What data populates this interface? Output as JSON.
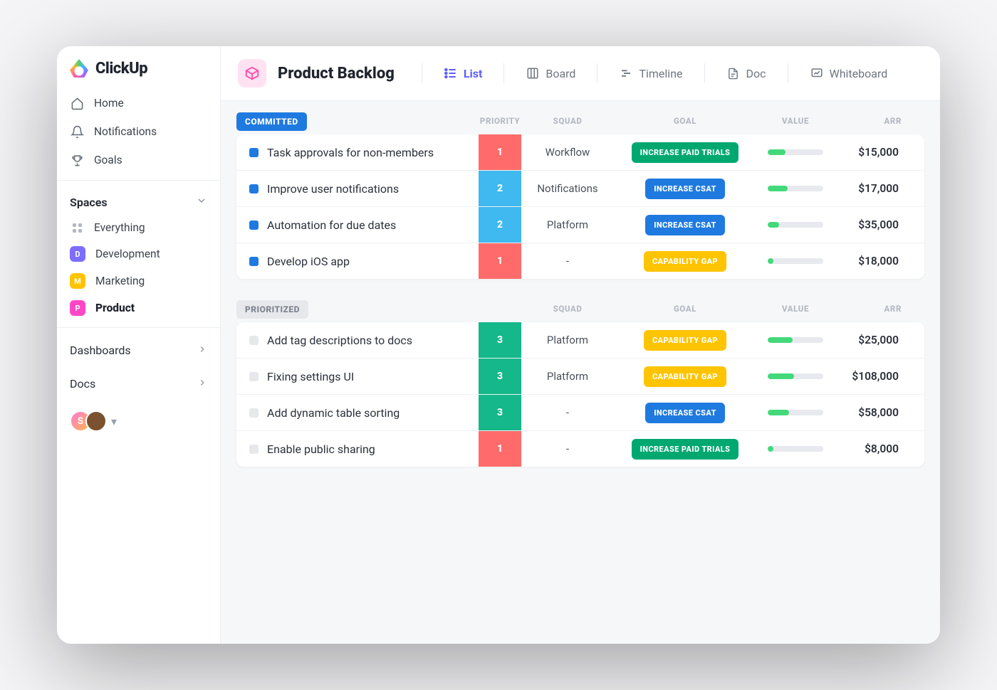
{
  "brand": "ClickUp",
  "sidebar": {
    "nav": [
      {
        "label": "Home"
      },
      {
        "label": "Notifications"
      },
      {
        "label": "Goals"
      }
    ],
    "spaces_label": "Spaces",
    "spaces": [
      {
        "label": "Everything",
        "kind": "everything"
      },
      {
        "label": "Development",
        "badge": "D",
        "color": "#7c6dff"
      },
      {
        "label": "Marketing",
        "badge": "M",
        "color": "#ffc400"
      },
      {
        "label": "Product",
        "badge": "P",
        "color": "#ff47c6",
        "active": true
      }
    ],
    "links": [
      {
        "label": "Dashboards"
      },
      {
        "label": "Docs"
      }
    ],
    "avatars": [
      {
        "initial": "S"
      },
      {
        "initial": ""
      }
    ]
  },
  "header": {
    "title": "Product Backlog",
    "views": [
      {
        "label": "List",
        "active": true
      },
      {
        "label": "Board"
      },
      {
        "label": "Timeline"
      },
      {
        "label": "Doc"
      },
      {
        "label": "Whiteboard"
      }
    ]
  },
  "columns": {
    "priority": "PRIORITY",
    "squad": "SQUAD",
    "goal": "GOAL",
    "value": "VALUE",
    "arr": "ARR"
  },
  "goal_styles": {
    "INCREASE PAID TRIALS": "goal-green",
    "INCREASE CSAT": "goal-blue",
    "CAPABILITY GAP": "goal-yellow"
  },
  "prio_styles": {
    "1": "prio-1",
    "2": "prio-2",
    "3": "prio-3"
  },
  "groups": [
    {
      "name": "COMMITTED",
      "chip_class": "chip-committed",
      "dot_class": "dot-blue",
      "show_priority_header": true,
      "rows": [
        {
          "task": "Task approvals for non-members",
          "priority": "1",
          "squad": "Workflow",
          "goal": "INCREASE PAID TRIALS",
          "value": 32,
          "arr": "$15,000"
        },
        {
          "task": "Improve  user notifications",
          "priority": "2",
          "squad": "Notifications",
          "goal": "INCREASE CSAT",
          "value": 36,
          "arr": "$17,000"
        },
        {
          "task": "Automation for due dates",
          "priority": "2",
          "squad": "Platform",
          "goal": "INCREASE CSAT",
          "value": 20,
          "arr": "$35,000"
        },
        {
          "task": "Develop iOS app",
          "priority": "1",
          "squad": "-",
          "goal": "CAPABILITY GAP",
          "value": 10,
          "arr": "$18,000"
        }
      ]
    },
    {
      "name": "PRIORITIZED",
      "chip_class": "chip-prioritized",
      "dot_class": "dot-grey",
      "show_priority_header": false,
      "rows": [
        {
          "task": "Add tag descriptions to docs",
          "priority": "3",
          "squad": "Platform",
          "goal": "CAPABILITY GAP",
          "value": 45,
          "arr": "$25,000"
        },
        {
          "task": "Fixing settings UI",
          "priority": "3",
          "squad": "Platform",
          "goal": "CAPABILITY GAP",
          "value": 48,
          "arr": "$108,000"
        },
        {
          "task": "Add dynamic table sorting",
          "priority": "3",
          "squad": "-",
          "goal": "INCREASE CSAT",
          "value": 38,
          "arr": "$58,000"
        },
        {
          "task": "Enable public sharing",
          "priority": "1",
          "squad": "-",
          "goal": "INCREASE PAID TRIALS",
          "value": 10,
          "arr": "$8,000"
        }
      ]
    }
  ]
}
